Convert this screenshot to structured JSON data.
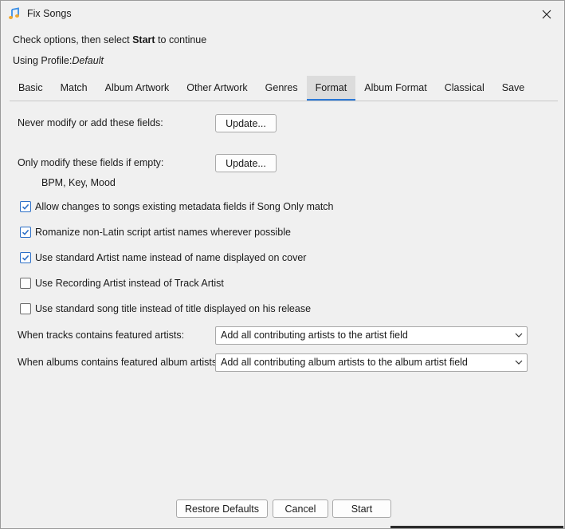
{
  "window": {
    "title": "Fix Songs"
  },
  "header": {
    "instruction_before": "Check options, then select ",
    "instruction_bold": "Start",
    "instruction_after": " to continue",
    "profile_label": "Using Profile:",
    "profile_value": "Default"
  },
  "tabs": [
    {
      "label": "Basic"
    },
    {
      "label": "Match"
    },
    {
      "label": "Album Artwork"
    },
    {
      "label": "Other Artwork"
    },
    {
      "label": "Genres"
    },
    {
      "label": "Format",
      "active": true
    },
    {
      "label": "Album Format"
    },
    {
      "label": "Classical"
    },
    {
      "label": "Save"
    }
  ],
  "format": {
    "never_modify_label": "Never modify or add these fields:",
    "never_modify_button": "Update...",
    "only_if_empty_label": "Only modify these fields if empty:",
    "only_if_empty_button": "Update...",
    "only_if_empty_fields": "BPM, Key, Mood",
    "checkboxes": [
      {
        "label": "Allow changes to songs existing metadata fields if Song Only match",
        "checked": true
      },
      {
        "label": "Romanize non-Latin script artist names wherever possible",
        "checked": true
      },
      {
        "label": "Use standard Artist name instead of name displayed on cover",
        "checked": true
      },
      {
        "label": "Use Recording Artist instead of Track Artist",
        "checked": false
      },
      {
        "label": "Use standard song title instead of title displayed on his release",
        "checked": false
      }
    ],
    "featured_artists_label": "When tracks contains featured artists:",
    "featured_artists_value": "Add all contributing artists to the artist field",
    "featured_album_artists_label": "When albums contains featured album artists:",
    "featured_album_artists_value": "Add all contributing album artists to the album artist field"
  },
  "footer": {
    "restore_defaults": "Restore Defaults",
    "cancel": "Cancel",
    "start": "Start"
  },
  "colors": {
    "accent": "#2a78d6",
    "check": "#2c6fc7"
  },
  "icons": {
    "app": "music-note-icon",
    "close": "close-icon",
    "dropdown": "chevron-down-icon",
    "check": "checkmark-icon"
  }
}
